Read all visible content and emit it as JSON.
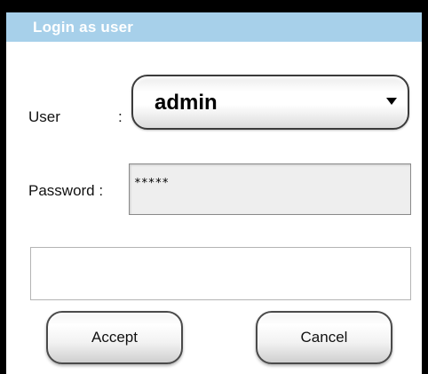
{
  "dialog": {
    "title": "Login as user"
  },
  "form": {
    "user_label": "User",
    "user_colon": ":",
    "user_value": "admin",
    "password_label": "Password :",
    "password_value": "*****",
    "message": ""
  },
  "buttons": {
    "accept_label": "Accept",
    "cancel_label": "Cancel"
  },
  "colors": {
    "title_bar": "#a7d0ea",
    "frame": "#000000",
    "password_bg": "#eeeeee"
  },
  "icons": {
    "dropdown": "chevron-down-icon"
  }
}
